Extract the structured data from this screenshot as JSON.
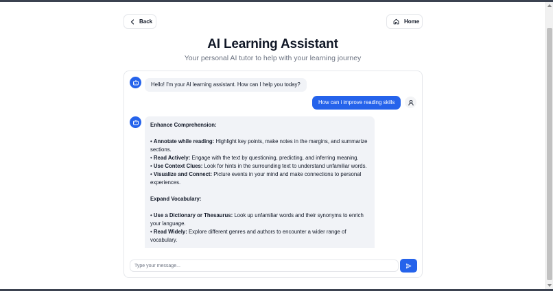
{
  "nav": {
    "back_label": "Back",
    "home_label": "Home"
  },
  "header": {
    "title": "AI Learning Assistant",
    "subtitle": "Your personal AI tutor to help with your learning journey"
  },
  "messages": [
    {
      "role": "assistant",
      "text": "Hello! I'm your AI learning assistant. How can I help you today?"
    },
    {
      "role": "user",
      "text": "How can i improve reading skills"
    },
    {
      "role": "assistant",
      "sections": [
        {
          "heading": "Enhance Comprehension:",
          "bullets": [
            {
              "bold": "Annotate while reading:",
              "text": " Highlight key points, make notes in the margins, and summarize sections."
            },
            {
              "bold": "Read Actively:",
              "text": " Engage with the text by questioning, predicting, and inferring meaning."
            },
            {
              "bold": "Use Context Clues:",
              "text": " Look for hints in the surrounding text to understand unfamiliar words."
            },
            {
              "bold": "Visualize and Connect:",
              "text": " Picture events in your mind and make connections to personal experiences."
            }
          ]
        },
        {
          "heading": "Expand Vocabulary:",
          "bullets": [
            {
              "bold": "Use a Dictionary or Thesaurus:",
              "text": " Look up unfamiliar words and their synonyms to enrich your language."
            },
            {
              "bold": "Read Widely:",
              "text": " Explore different genres and authors to encounter a wider range of vocabulary."
            }
          ]
        }
      ]
    }
  ],
  "composer": {
    "placeholder": "Type your message..."
  },
  "colors": {
    "accent": "#2563eb",
    "bot_bubble": "#f1f3f7",
    "title_text": "#111827",
    "subtitle_text": "#6b7280"
  },
  "icons": {
    "back": "chevron-left-icon",
    "home": "home-icon",
    "bot": "bot-icon",
    "user": "user-icon",
    "send": "send-icon"
  }
}
